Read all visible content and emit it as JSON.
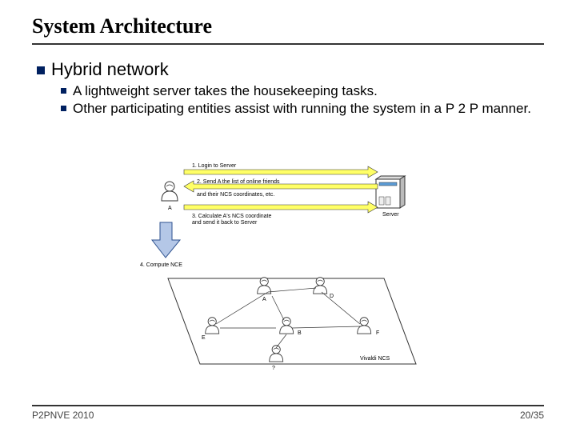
{
  "title": "System Architecture",
  "bullets": {
    "main": "Hybrid network",
    "sub1": "A lightweight server takes the housekeeping tasks.",
    "sub2": "Other participating entities assist with running the system in a P 2 P manner."
  },
  "steps": {
    "s1": "1. Login to Server",
    "s2a": "2. Send A the list of online friends",
    "s2b": "and their NCS coordinates, etc.",
    "s3a": "3. Calculate A's NCS coordinate",
    "s3b": "and send it back to Server",
    "s4": "4. Compute NCE"
  },
  "labels": {
    "userA": "A",
    "server": "Server",
    "ncs": "Vivaldi NCS",
    "pA": "A",
    "pB": "B",
    "pD": "D",
    "pE": "E",
    "pF": "F",
    "pQ": "?"
  },
  "footer": {
    "left": "P2PNVE 2010",
    "right": "20/35"
  }
}
